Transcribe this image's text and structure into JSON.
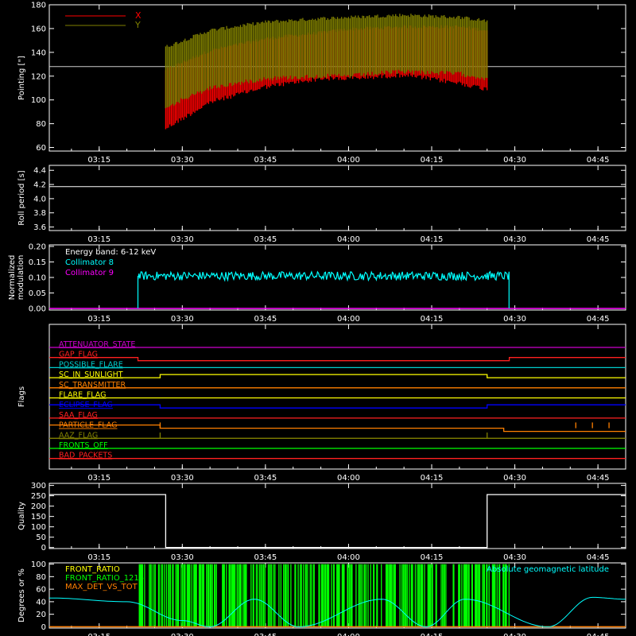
{
  "time_axis": {
    "range": [
      "03:06",
      "04:50"
    ],
    "ticks": [
      "03:15",
      "03:30",
      "03:45",
      "04:00",
      "04:15",
      "04:30",
      "04:45"
    ]
  },
  "chart_data": [
    {
      "type": "area",
      "ylabel": "Pointing [\"]",
      "ylim": [
        57,
        180
      ],
      "yticks": [
        60,
        80,
        100,
        120,
        140,
        160,
        180
      ],
      "legend": [
        {
          "name": "X",
          "color": "#ff0000"
        },
        {
          "name": "Y",
          "color": "#808000"
        }
      ],
      "reference_line": 128,
      "data_start": "03:27",
      "data_end": "04:25",
      "series": [
        {
          "name": "X",
          "color": "#ff0000",
          "x": [
            "03:27",
            "03:35",
            "03:45",
            "03:55",
            "04:00",
            "04:10",
            "04:20",
            "04:25"
          ],
          "lower": [
            78,
            100,
            113,
            120,
            120,
            123,
            116,
            111
          ],
          "upper": [
            124,
            140,
            150,
            155,
            158,
            160,
            160,
            157
          ]
        },
        {
          "name": "Y",
          "color": "#808000",
          "x": [
            "03:27",
            "03:35",
            "03:45",
            "03:55",
            "04:00",
            "04:10",
            "04:20",
            "04:25"
          ],
          "lower": [
            96,
            112,
            120,
            122,
            122,
            126,
            124,
            120
          ],
          "upper": [
            143,
            157,
            164,
            167,
            168,
            170,
            168,
            165
          ]
        }
      ]
    },
    {
      "type": "line",
      "ylabel": "Roll period [s]",
      "ylim": [
        3.55,
        4.47
      ],
      "yticks": [
        "3.6",
        "3.8",
        "4.0",
        "4.2",
        "4.4"
      ],
      "series": [
        {
          "color": "#ffffff",
          "x": [
            "03:06",
            "04:50"
          ],
          "y": [
            4.17,
            4.17
          ]
        }
      ]
    },
    {
      "type": "line",
      "ylabel": "Normalized modulation",
      "ylim": [
        -0.005,
        0.205
      ],
      "yticks": [
        "0.00",
        "0.05",
        "0.10",
        "0.15",
        "0.20"
      ],
      "annotation": "Energy band: 6-12 keV",
      "series": [
        {
          "name": "Collimator 8",
          "color": "#00ffff",
          "start": "03:22",
          "end": "04:29",
          "mean": 0.105,
          "spread": 0.014
        },
        {
          "name": "Collimator 9",
          "color": "#ff00ff",
          "y_const": 0.0
        }
      ]
    },
    {
      "type": "line",
      "ylabel": "Flags",
      "flags": [
        {
          "name": "ATTENUATOR_STATE",
          "color": "#cc00cc",
          "state": [
            [
              "03:06",
              0
            ],
            [
              "04:50",
              0
            ]
          ]
        },
        {
          "name": "GAP_FLAG",
          "color": "#ff2020",
          "state": [
            [
              "03:06",
              0
            ],
            [
              "03:22",
              -1
            ],
            [
              "04:29",
              0
            ]
          ]
        },
        {
          "name": "POSSIBLE_FLARE",
          "color": "#00cccc",
          "state": [
            [
              "03:06",
              0
            ]
          ]
        },
        {
          "name": "SC_IN_SUNLIGHT",
          "color": "#ffff00",
          "state": [
            [
              "03:06",
              0
            ],
            [
              "03:26",
              1
            ],
            [
              "04:25",
              0
            ]
          ]
        },
        {
          "name": "SC_TRANSMITTER",
          "color": "#ff8000",
          "state": [
            [
              "03:06",
              0
            ]
          ]
        },
        {
          "name": "FLARE_FLAG",
          "color": "#ffff00",
          "state": [
            [
              "03:06",
              0
            ]
          ]
        },
        {
          "name": "ECLIPSE_FLAG",
          "color": "#0000ff",
          "state": [
            [
              "03:06",
              1
            ],
            [
              "03:26",
              0
            ],
            [
              "04:25",
              1
            ]
          ]
        },
        {
          "name": "SAA_FLAG",
          "color": "#ff2020",
          "state": [
            [
              "03:06",
              0
            ]
          ]
        },
        {
          "name": "PARTICLE_FLAG",
          "color": "#ff8000",
          "state": [
            [
              "03:06",
              1
            ],
            [
              "03:26",
              0
            ],
            [
              "04:26",
              0
            ],
            [
              "04:28",
              -1
            ]
          ],
          "spikes": [
            "03:26",
            "04:41",
            "04:44",
            "04:47"
          ]
        },
        {
          "name": "AAZ_FLAG",
          "color": "#808000",
          "state": [
            [
              "03:06",
              0
            ]
          ],
          "spikes": [
            "03:26",
            "04:25"
          ]
        },
        {
          "name": "FRONTS_OFF",
          "color": "#00ff00",
          "state": [
            [
              "03:06",
              0
            ]
          ]
        },
        {
          "name": "BAD_PACKETS",
          "color": "#ff2020",
          "state": [
            [
              "03:06",
              0
            ]
          ]
        }
      ]
    },
    {
      "type": "line",
      "ylabel": "Quality",
      "ylim": [
        -5,
        310
      ],
      "yticks": [
        0,
        50,
        100,
        150,
        200,
        250,
        300
      ],
      "series": [
        {
          "color": "#ffffff",
          "x": [
            "03:06",
            "03:27",
            "03:27",
            "04:25",
            "04:25",
            "04:50"
          ],
          "y": [
            256,
            256,
            0,
            0,
            256,
            256
          ]
        }
      ]
    },
    {
      "type": "line",
      "ylabel": "Degrees or %",
      "ylim": [
        -2,
        102
      ],
      "yticks": [
        0,
        20,
        40,
        60,
        80,
        100
      ],
      "legend": [
        {
          "name": "FRONT_RATIO",
          "color": "#ffff00"
        },
        {
          "name": "FRONT_RATIO_1215",
          "color": "#00ff00"
        },
        {
          "name": "MAX_DET_VS_TOT",
          "color": "#ff8000"
        }
      ],
      "right_label": "Absolute geomagnetic latitude",
      "green_band": {
        "start": "03:22",
        "end": "04:29",
        "color": "#00ff00"
      },
      "series": [
        {
          "name": "Absolute geomagnetic latitude",
          "color": "#00ffff",
          "x": [
            "03:06",
            "03:20",
            "03:30",
            "03:35",
            "03:43",
            "03:51",
            "04:06",
            "04:14",
            "04:21",
            "04:36",
            "04:44",
            "04:50"
          ],
          "y": [
            46,
            40,
            10,
            0,
            44,
            0,
            44,
            0,
            44,
            0,
            47,
            44
          ]
        },
        {
          "name": "MAX_DET_VS_TOT",
          "color": "#ff8000",
          "y_const": 0
        }
      ]
    }
  ]
}
